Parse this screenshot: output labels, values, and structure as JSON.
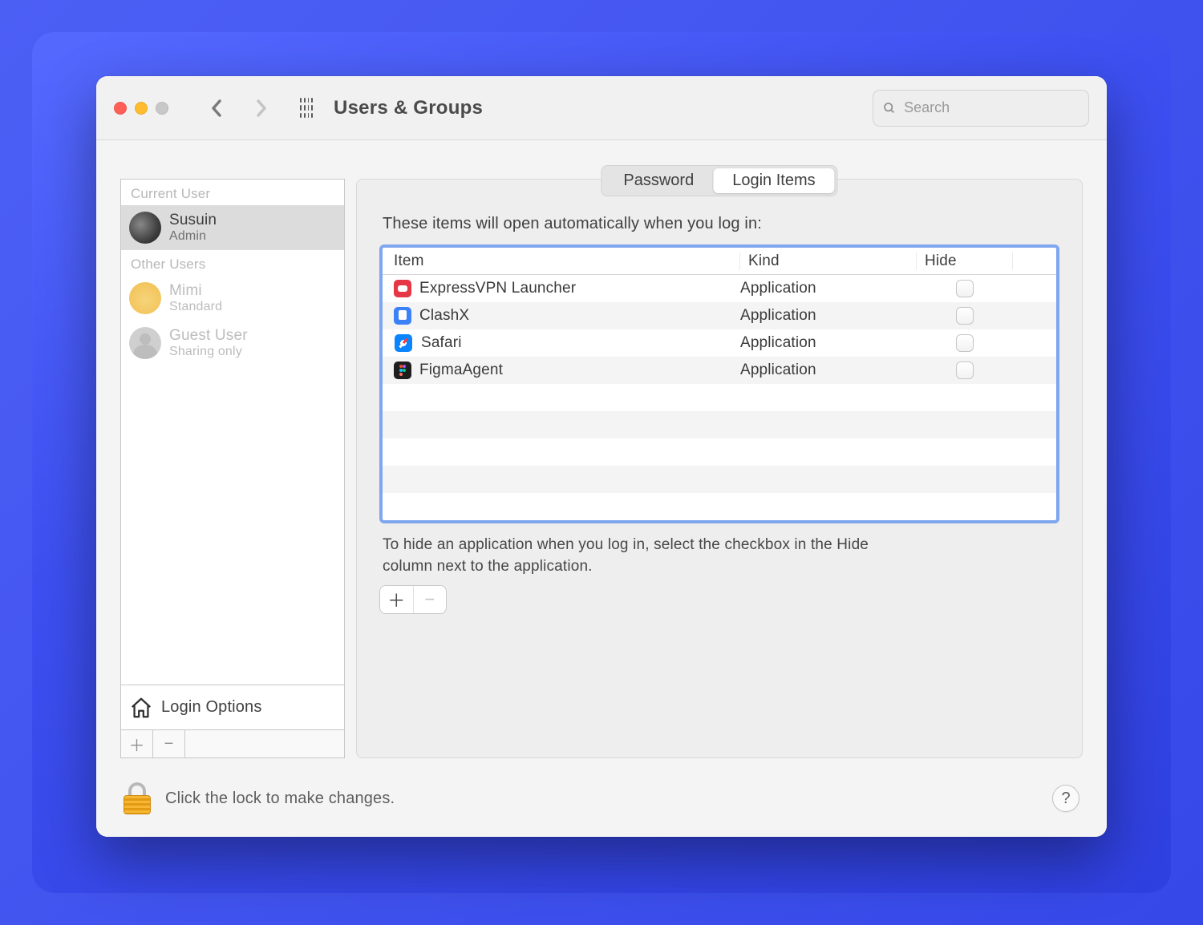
{
  "header": {
    "title": "Users & Groups",
    "search_placeholder": "Search"
  },
  "sidebar": {
    "current_user_header": "Current User",
    "other_users_header": "Other Users",
    "current": {
      "name": "Susuin",
      "role": "Admin"
    },
    "others": [
      {
        "name": "Mimi",
        "role": "Standard"
      },
      {
        "name": "Guest User",
        "role": "Sharing only"
      }
    ],
    "login_options_label": "Login Options"
  },
  "tabs": {
    "password": "Password",
    "login_items": "Login Items"
  },
  "login_items": {
    "subtitle": "These items will open automatically when you log in:",
    "columns": {
      "item": "Item",
      "kind": "Kind",
      "hide": "Hide"
    },
    "rows": [
      {
        "name": "ExpressVPN Launcher",
        "kind": "Application",
        "icon": "express"
      },
      {
        "name": "ClashX",
        "kind": "Application",
        "icon": "clashx"
      },
      {
        "name": "Safari",
        "kind": "Application",
        "icon": "safari"
      },
      {
        "name": "FigmaAgent",
        "kind": "Application",
        "icon": "figma"
      }
    ],
    "hint": "To hide an application when you log in, select the checkbox in the Hide column next to the application."
  },
  "footer": {
    "lock_text": "Click the lock to make changes."
  }
}
